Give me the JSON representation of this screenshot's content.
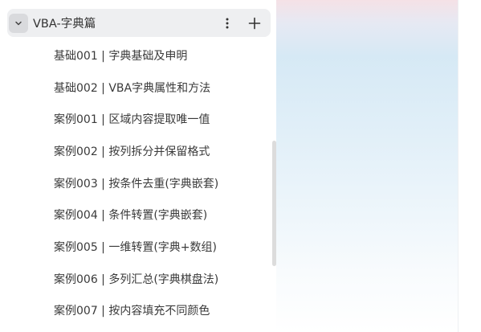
{
  "group": {
    "title": "VBA-字典篇",
    "toggle_icon": "chevron-down-icon",
    "more_icon": "more-vertical-icon",
    "add_icon": "plus-icon"
  },
  "items": [
    {
      "label": "基础001 | 字典基础及申明"
    },
    {
      "label": "基础002 | VBA字典属性和方法"
    },
    {
      "label": "案例001 | 区域内容提取唯一值"
    },
    {
      "label": "案例002 | 按列拆分并保留格式"
    },
    {
      "label": "案例003 | 按条件去重(字典嵌套)"
    },
    {
      "label": "案例004 | 条件转置(字典嵌套)"
    },
    {
      "label": "案例005 | 一维转置(字典+数组)"
    },
    {
      "label": "案例006 | 多列汇总(字典棋盘法)"
    },
    {
      "label": "案例007 | 按内容填充不同颜色"
    }
  ],
  "colors": {
    "header_bg": "#eeeff1",
    "toggle_bg": "#d9dadd",
    "text": "#3a3a3a"
  }
}
